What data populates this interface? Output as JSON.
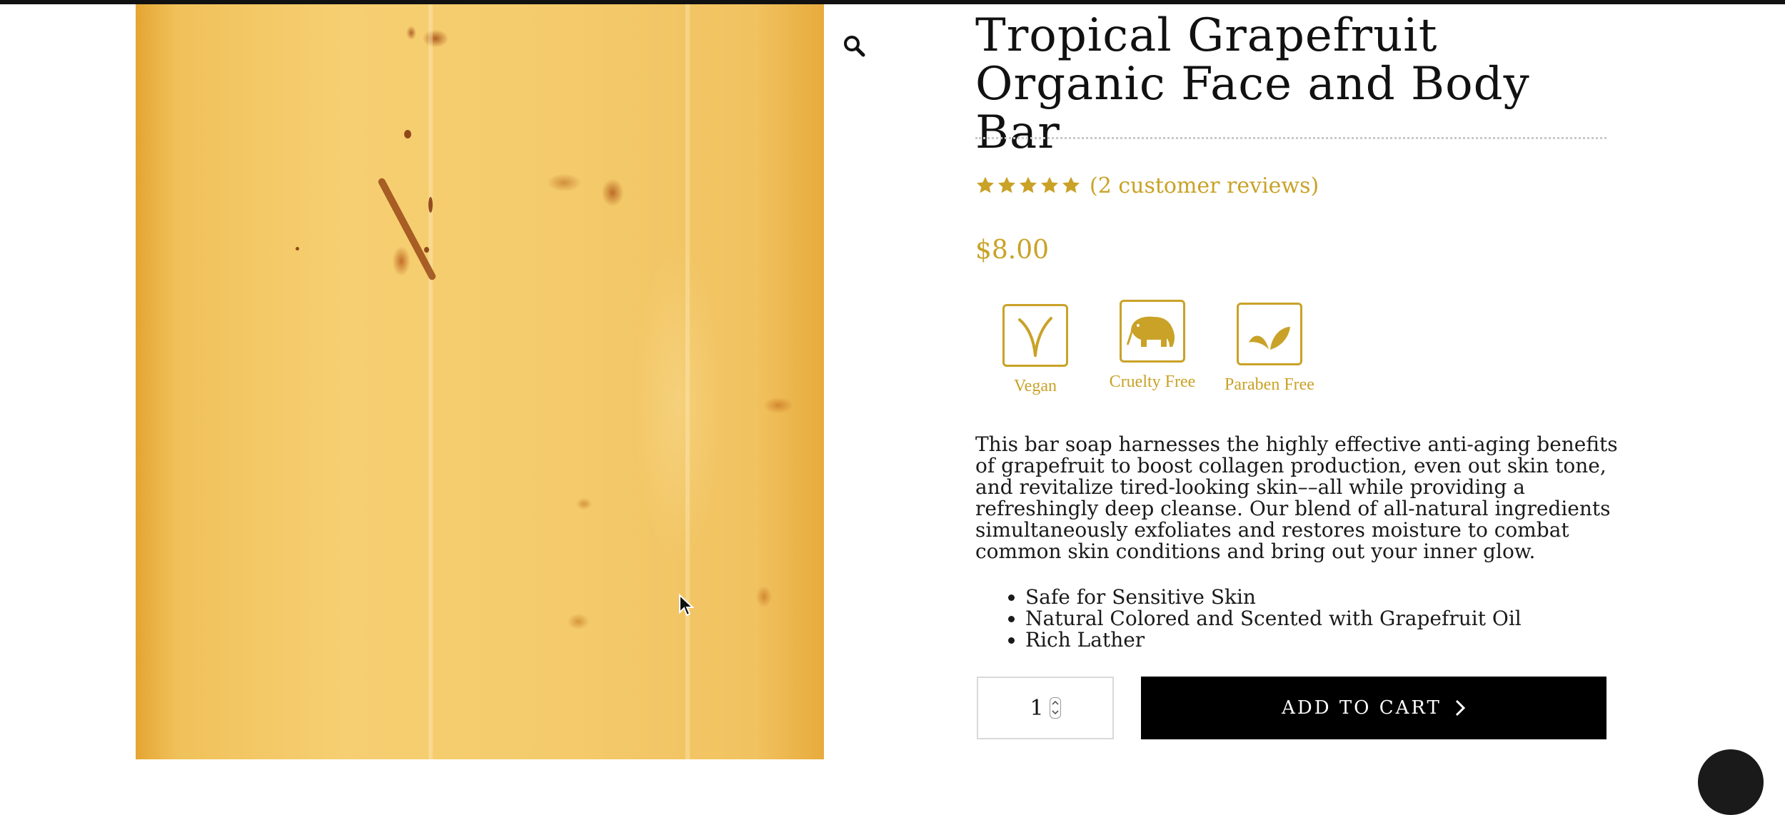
{
  "product": {
    "title": "Tropical Grapefruit Organic Face and Body Bar",
    "rating": 5,
    "rating_max": 5,
    "review_link": "(2 customer reviews)",
    "price": "$8.00",
    "badges": [
      {
        "label": "Vegan",
        "icon": "sprout-icon"
      },
      {
        "label": "Cruelty Free",
        "icon": "elephant-icon"
      },
      {
        "label": "Paraben Free",
        "icon": "leaves-icon"
      }
    ],
    "description": "This bar soap harnesses the highly effective anti-aging benefits of grapefruit to boost collagen production, even out skin tone, and revitalize tired-looking skin––all while providing a refreshingly deep cleanse. Our blend of all-natural ingredients simultaneously exfoliates and restores moisture to combat common skin conditions and bring out your inner glow.",
    "features": [
      "Safe for Sensitive Skin",
      "Natural Colored and Scented with Grapefruit Oil",
      "Rich Lather"
    ]
  },
  "cart": {
    "quantity": "1",
    "add_to_cart_label": "ADD TO CART"
  },
  "colors": {
    "accent": "#c9a227",
    "button_bg": "#000000",
    "text": "#1a1a1a"
  },
  "icons": {
    "zoom": "magnifier-icon",
    "cursor": "mouse-pointer-icon",
    "chat": "chat-widget-icon"
  }
}
